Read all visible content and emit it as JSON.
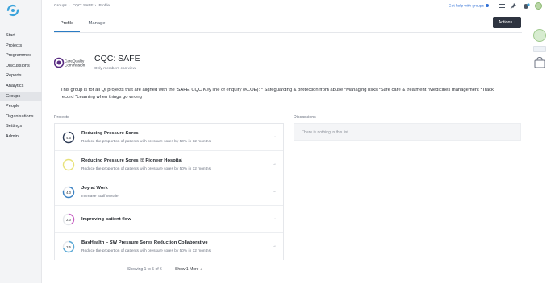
{
  "sidebar": {
    "items": [
      {
        "label": "Start"
      },
      {
        "label": "Projects"
      },
      {
        "label": "Programmes"
      },
      {
        "label": "Discussions"
      },
      {
        "label": "Reports"
      },
      {
        "label": "Analytics"
      },
      {
        "label": "Groups"
      },
      {
        "label": "People"
      },
      {
        "label": "Organisations"
      },
      {
        "label": "Settings"
      },
      {
        "label": "Admin"
      }
    ],
    "active": "Groups"
  },
  "breadcrumb": [
    "Groups",
    "CQC: SAFE",
    "Profile"
  ],
  "header": {
    "help_label": "Get help with groups"
  },
  "tabs": [
    {
      "label": "Profile"
    },
    {
      "label": "Manage"
    }
  ],
  "actions_label": "Actions ↓",
  "group": {
    "logo_text_1": "CareQuality",
    "logo_text_2": "Commission",
    "title": "CQC: SAFE",
    "visibility": "Only members can view",
    "description": "This group is for all QI projects that are aligned with the 'SAFE' CQC Key line of enquiry (KLOE): * Safeguarding & protection from abuse *Managing risks *Safe care & treatment *Medicines management *Track record *Learning when things go wrong"
  },
  "projects_label": "Projects",
  "discussions_label": "Discussions",
  "discussions_empty": "There is nothing in this list",
  "projects": [
    {
      "title": "Reducing Pressure Sores",
      "desc": "Reduce the proportion of patients with pressure sores by 50% in 12 months.",
      "score": "4.5",
      "color": "#2d3b55",
      "progress": 0.9
    },
    {
      "title": "Reducing Pressure Sores @ Pioneer Hospital",
      "desc": "Reduce the proportion of patients with pressure sores by 50% in 12 months.",
      "score": "",
      "color": "#e8e27a",
      "progress": 0
    },
    {
      "title": "Joy at Work",
      "desc": "Increase Staff Morale",
      "score": "4.0",
      "color": "#3b82c4",
      "progress": 0.8
    },
    {
      "title": "Improving patient flow",
      "desc": "",
      "score": "2.0",
      "color": "#c85cc3",
      "progress": 0.4
    },
    {
      "title": "BayHealth – SW Pressure Sores Reduction Collaborative",
      "desc": "Reduce the proportion of patients with pressure sores by 50% in 12 months.",
      "score": "3.5",
      "color": "#5aa9d6",
      "progress": 0.7
    }
  ],
  "paging": {
    "text": "Showing 1 to 5 of 6",
    "show_more": "Show 1 More ↓"
  },
  "icons": [
    "sync-logo-icon",
    "info-icon",
    "list-icon",
    "pin-icon",
    "notification-icon",
    "user-avatar",
    "bag-icon",
    "chevron-right-icon"
  ]
}
